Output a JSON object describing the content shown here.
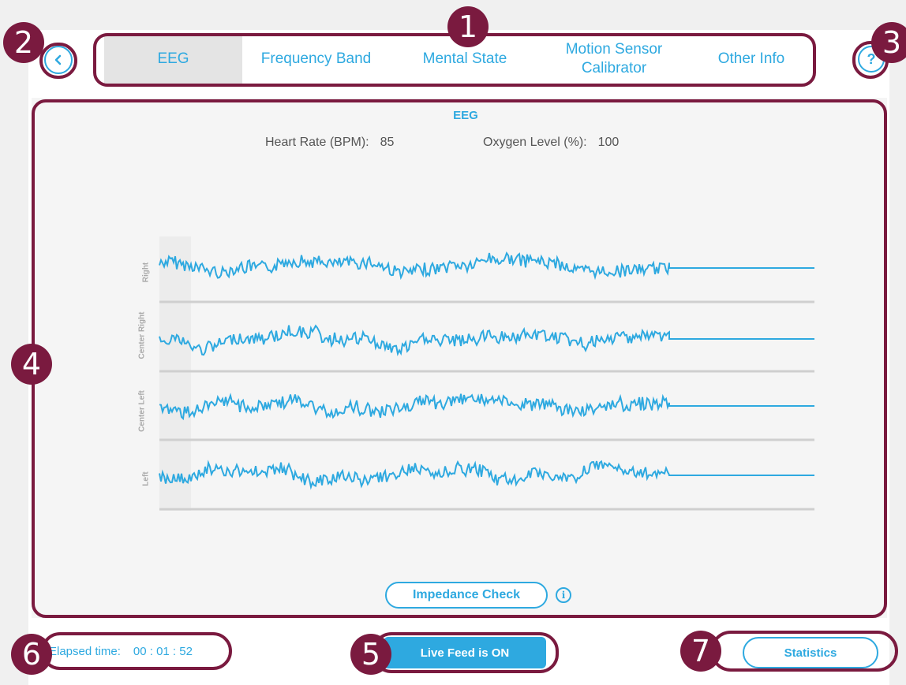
{
  "tabs": [
    {
      "label": "EEG",
      "active": true
    },
    {
      "label": "Frequency Band",
      "active": false
    },
    {
      "label": "Mental State",
      "active": false
    },
    {
      "label": "Motion Sensor Calibrator",
      "active": false
    },
    {
      "label": "Other Info",
      "active": false
    }
  ],
  "header": {
    "back_icon": "chevron-left-icon",
    "help_icon": "question-circle-icon",
    "help_glyph": "?"
  },
  "panel": {
    "title": "EEG",
    "heart_rate_label": "Heart Rate (BPM):",
    "heart_rate_value": "85",
    "oxygen_label": "Oxygen Level (%):",
    "oxygen_value": "100",
    "channels": [
      "Right",
      "Center Right",
      "Center Left",
      "Left"
    ],
    "impedance_label": "Impedance Check",
    "info_glyph": "i"
  },
  "footer": {
    "elapsed_label": "Elapsed time:",
    "elapsed_value": "00 : 01 : 52",
    "live_feed_label": "Live Feed is ON",
    "statistics_label": "Statistics"
  },
  "markers": [
    "1",
    "2",
    "3",
    "4",
    "5",
    "6",
    "7"
  ],
  "colors": {
    "accent": "#2ea9e0",
    "callout": "#7a1a3f",
    "active_tab": "#e4e4e4"
  }
}
